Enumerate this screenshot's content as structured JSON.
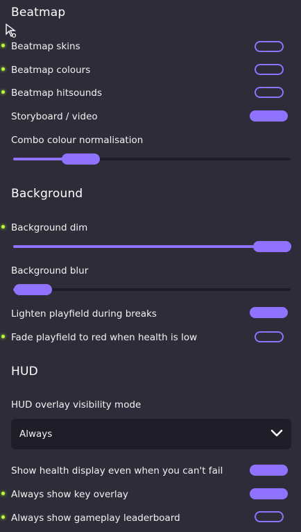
{
  "beatmap": {
    "title": "Beatmap",
    "skins": {
      "label": "Beatmap skins",
      "on": false
    },
    "colours": {
      "label": "Beatmap colours",
      "on": false
    },
    "hitsounds": {
      "label": "Beatmap hitsounds",
      "on": false
    },
    "storyboard": {
      "label": "Storyboard / video",
      "on": true
    },
    "combo": {
      "label": "Combo colour normalisation",
      "value": 0.2
    }
  },
  "background": {
    "title": "Background",
    "dim": {
      "label": "Background dim",
      "value": 1.0
    },
    "blur": {
      "label": "Background blur",
      "value": 0.0
    },
    "lighten": {
      "label": "Lighten playfield during breaks",
      "on": true
    },
    "fade": {
      "label": "Fade playfield to red when health is low",
      "on": false
    }
  },
  "hud": {
    "title": "HUD",
    "visibility": {
      "label": "HUD overlay visibility mode",
      "value": "Always"
    },
    "health": {
      "label": "Show health display even when you can't fail",
      "on": true
    },
    "keyoverlay": {
      "label": "Always show key overlay",
      "on": true
    },
    "leaderboard": {
      "label": "Always show gameplay leaderboard",
      "on": false
    }
  },
  "colors": {
    "accent": "#8f73ff",
    "indicator": "#b8ff3a",
    "background": "#2e2c38",
    "field": "#1f1d27"
  }
}
